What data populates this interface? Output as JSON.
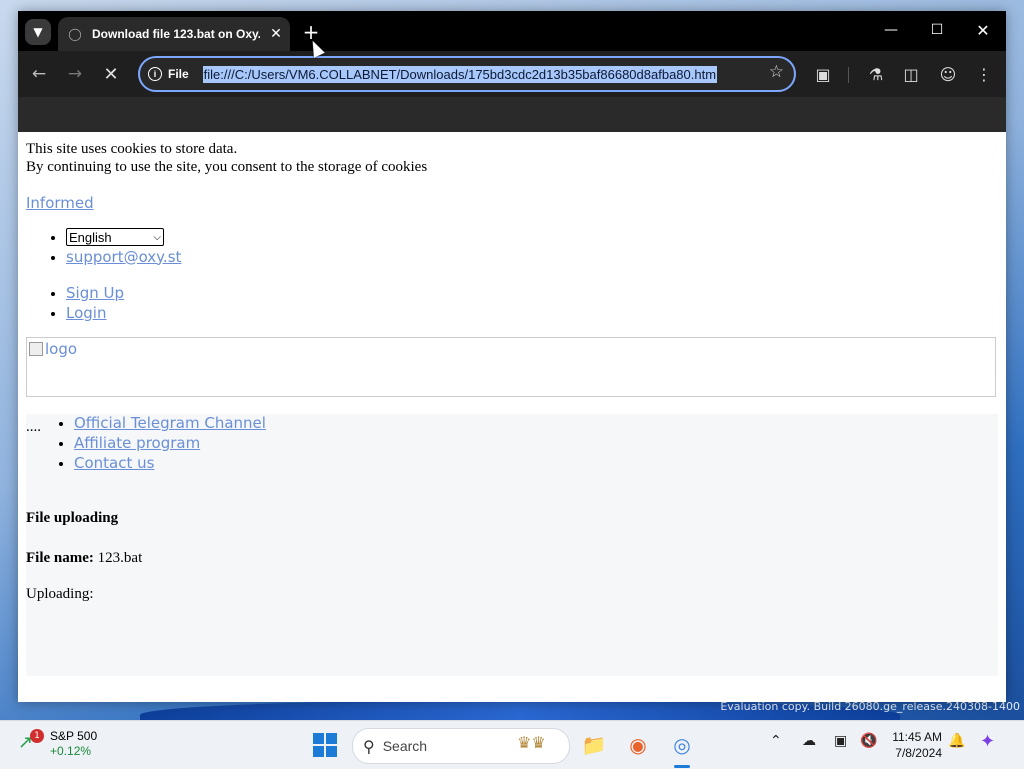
{
  "desktop": {
    "watermark": "Evaluation copy. Build 26080.ge_release.240308-1400"
  },
  "browser": {
    "tab": {
      "title": "Download file 123.bat on Oxy.(",
      "favicon": "globe-icon"
    },
    "omnibox": {
      "chip_label": "File",
      "url": "file:///C:/Users/VM6.COLLABNET/Downloads/175bd3cdc2d13b35baf86680d8afba80.htm"
    },
    "accent_color": "#7ca7ff"
  },
  "page": {
    "cookie_line1": "This site uses cookies to store data.",
    "cookie_line2": "By continuing to use the site, you consent to the storage of cookies",
    "informed_link": "Informed",
    "language_selected": "English",
    "support_email": "support@oxy.st",
    "signup_link": "Sign Up",
    "login_link": "Login",
    "logo_alt": "logo",
    "ellipsis": "....",
    "nav_links": [
      "Official Telegram Channel",
      "Affiliate program",
      "Contact us"
    ],
    "upload_title": "File uploading",
    "file_name_label": "File name:",
    "file_name_value": "123.bat",
    "uploading_label": "Uploading:",
    "link_color": "#6a8fd6"
  },
  "taskbar": {
    "stock_name": "S&P 500",
    "stock_change": "+0.12%",
    "stock_badge": "1",
    "search_label": "Search",
    "time": "11:45 AM",
    "date": "7/8/2024"
  }
}
